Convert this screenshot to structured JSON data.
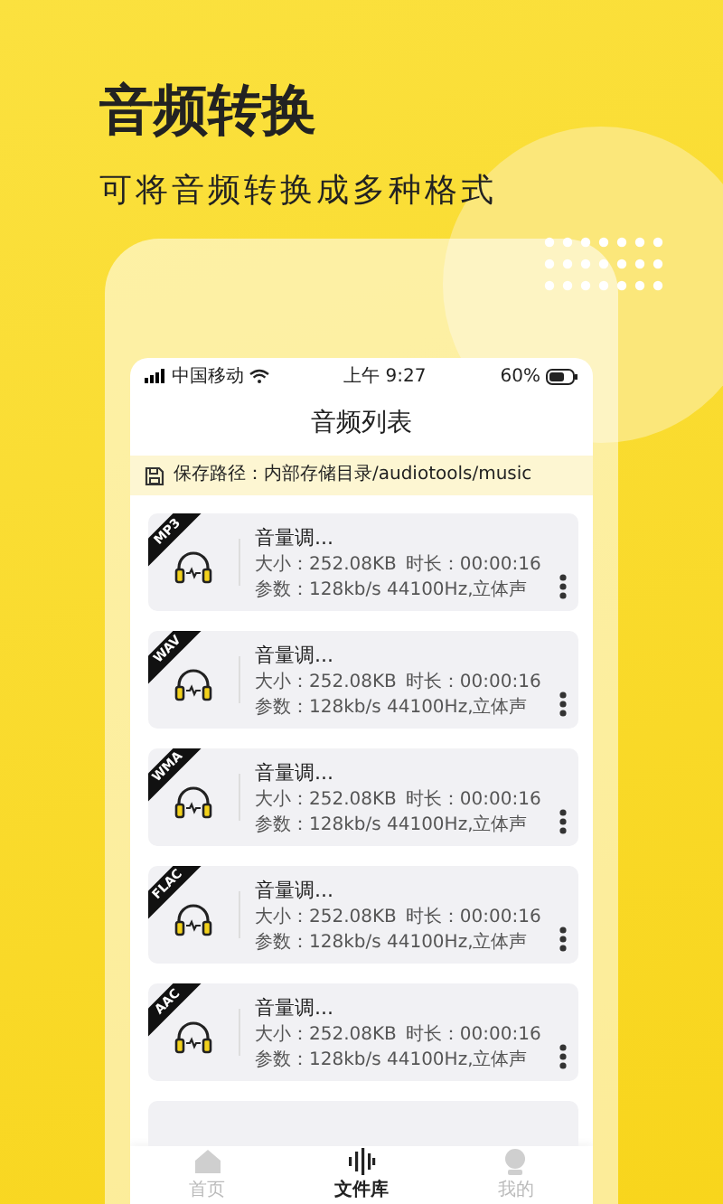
{
  "header": {
    "title": "音频转换",
    "subtitle": "可将音频转换成多种格式"
  },
  "status_bar": {
    "carrier": "中国移动",
    "time": "上午 9:27",
    "battery": "60%"
  },
  "page_title": "音频列表",
  "save_path": "保存路径：内部存储目录/audiotools/music",
  "files": [
    {
      "format": "MP3",
      "name": "音量调...",
      "size": "大小：252.08KB",
      "duration": "时长：00:00:16",
      "params": "参数：128kb/s  44100Hz,立体声"
    },
    {
      "format": "WAV",
      "name": "音量调...",
      "size": "大小：252.08KB",
      "duration": "时长：00:00:16",
      "params": "参数：128kb/s  44100Hz,立体声"
    },
    {
      "format": "WMA",
      "name": "音量调...",
      "size": "大小：252.08KB",
      "duration": "时长：00:00:16",
      "params": "参数：128kb/s  44100Hz,立体声"
    },
    {
      "format": "FLAC",
      "name": "音量调...",
      "size": "大小：252.08KB",
      "duration": "时长：00:00:16",
      "params": "参数：128kb/s  44100Hz,立体声"
    },
    {
      "format": "AAC",
      "name": "音量调...",
      "size": "大小：252.08KB",
      "duration": "时长：00:00:16",
      "params": "参数：128kb/s  44100Hz,立体声"
    }
  ],
  "tabs": [
    {
      "label": "首页",
      "kind": "home",
      "selected": false
    },
    {
      "label": "文件库",
      "kind": "library",
      "selected": true
    },
    {
      "label": "我的",
      "kind": "profile",
      "selected": false
    }
  ]
}
